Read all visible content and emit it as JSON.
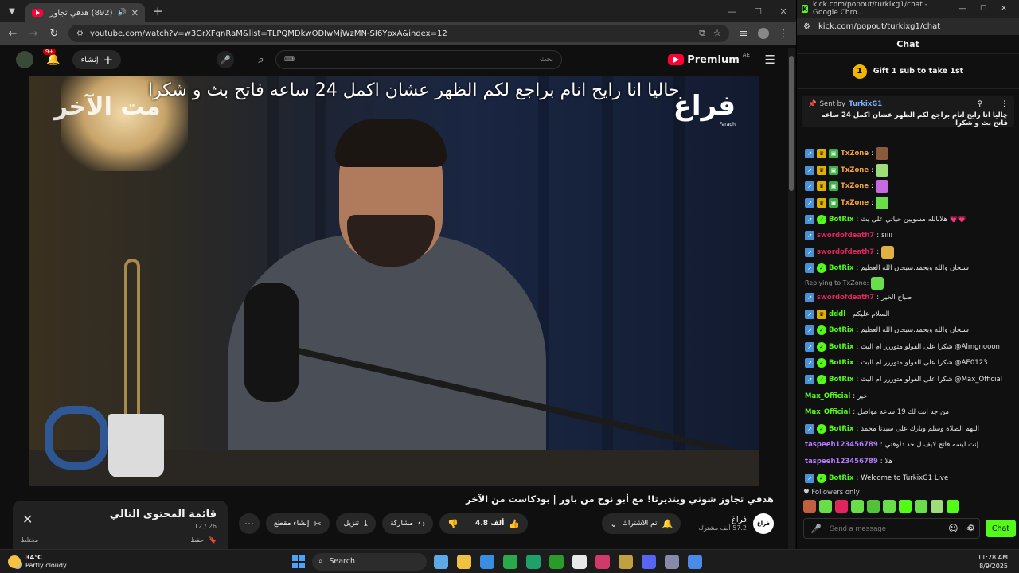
{
  "left_browser": {
    "tab_title": "(892) هدفي تجاوز شوني وينـ",
    "url": "youtube.com/watch?v=w3GrXFgnRaM&list=TLPQMDkwODIwMjWzMN-SI6YpxA&index=12",
    "win_controls": [
      "—",
      "☐",
      "✕"
    ]
  },
  "youtube": {
    "notif_count": "9+",
    "create_label": "إنشاء",
    "search_placeholder": "بحث",
    "premium_label": "Premium",
    "region": "AE",
    "video": {
      "caption": "حاليا انا رايح انام براجع لكم الظهر عشان اكمل 24 ساعه فاتح بث و شكرا",
      "brand_left": "مت الآخر",
      "brand_right": "فراغ",
      "brand_right_sub": "Faragh"
    },
    "title": "هدفي تجاوز شوني وينديرتا! مع أبو نوح من باور | بودكاست من الآخر",
    "channel": {
      "name": "فراغ",
      "subs": "57.2 ألف مشترك",
      "avatar_text": "فراغ"
    },
    "actions": {
      "subscribed": "تم الاشتراك",
      "likes": "4.8 ألف",
      "share": "مشاركة",
      "download": "تنزيل",
      "clip": "إنشاء مقطع",
      "more": "⋯"
    },
    "playlist": {
      "title": "قائمة المحتوى التالي",
      "count": "12 / 26",
      "save": "حفظ",
      "sort": "مختلط"
    }
  },
  "kick": {
    "window_title": "kick.com/popout/turkixg1/chat - Google Chro...",
    "url": "kick.com/popout/turkixg1/chat",
    "header": "Chat",
    "gift_text": "Gift 1 sub to take 1st",
    "gift_count": "1",
    "pinned": {
      "sent_by": "Sent by",
      "user": "TurkixG1",
      "message": "حاليا انا رايح انام براجع لكم الظهر عشان اكمل 24 ساعه فاتح بث و شكرا"
    },
    "messages": [
      {
        "user": "TxZone",
        "color": "#f2a33a",
        "text": "",
        "badges": [
          "link",
          "crown",
          "gift"
        ],
        "emote": "#8a5a3c"
      },
      {
        "user": "TxZone",
        "color": "#f2a33a",
        "text": "",
        "badges": [
          "link",
          "crown",
          "gift"
        ],
        "emote": "#9fdc7a"
      },
      {
        "user": "TxZone",
        "color": "#f2a33a",
        "text": "",
        "badges": [
          "link",
          "crown",
          "gift"
        ],
        "emote": "#c86adf"
      },
      {
        "user": "TxZone",
        "color": "#f2a33a",
        "text": "",
        "badges": [
          "link",
          "crown",
          "gift"
        ],
        "emote": "#6add4a"
      },
      {
        "user": "BotRix",
        "color": "#53fc18",
        "text": "هلابالله مسويين حياتي على بث 💗💗",
        "badges": [
          "link",
          "ver"
        ],
        "emote": ""
      },
      {
        "user": "swordofdeath7",
        "color": "#e0245e",
        "text": "siiii",
        "badges": [
          "link"
        ],
        "emote": ""
      },
      {
        "user": "swordofdeath7",
        "color": "#e0245e",
        "text": "",
        "badges": [
          "link"
        ],
        "emote": "#e0b040"
      },
      {
        "user": "BotRix",
        "color": "#53fc18",
        "text": "سبحان والله وبحمد.سبحان الله العظيم",
        "badges": [
          "link",
          "ver"
        ],
        "emote": ""
      },
      {
        "reply": "Replying to TxZone:",
        "emote": "#6add4a"
      },
      {
        "user": "swordofdeath7",
        "color": "#e0245e",
        "text": "صباح الخير",
        "badges": [
          "link"
        ],
        "emote": ""
      },
      {
        "user": "dddl",
        "color": "#53fc18",
        "text": "السلام عليكم",
        "badges": [
          "link",
          "crown"
        ],
        "emote": ""
      },
      {
        "user": "BotRix",
        "color": "#53fc18",
        "text": "سبحان والله وبحمد.سبحان الله العظيم",
        "badges": [
          "link",
          "ver"
        ],
        "emote": ""
      },
      {
        "user": "BotRix",
        "color": "#53fc18",
        "text": "شكرا على الفولو متوررر ام البث @Almgnooon",
        "badges": [
          "link",
          "ver"
        ],
        "emote": ""
      },
      {
        "user": "BotRix",
        "color": "#53fc18",
        "text": "شكرا على الفولو متوررر ام البث @AE0123",
        "badges": [
          "link",
          "ver"
        ],
        "emote": ""
      },
      {
        "user": "BotRix",
        "color": "#53fc18",
        "text": "شكرا على الفولو متوررر ام البث @Max_Official",
        "badges": [
          "link",
          "ver"
        ],
        "emote": ""
      },
      {
        "user": "Max_Official",
        "color": "#53fc18",
        "text": "خير",
        "badges": [],
        "emote": ""
      },
      {
        "user": "Max_Official",
        "color": "#53fc18",
        "text": "من جد انت لك 19 ساعه مواصل",
        "badges": [],
        "emote": ""
      },
      {
        "user": "BotRix",
        "color": "#53fc18",
        "text": "اللهم الصلاة وسلم وبارك على سيدنا محمد",
        "badges": [
          "link",
          "ver"
        ],
        "emote": ""
      },
      {
        "user": "taspeeh123456789",
        "color": "#b47aff",
        "text": "إنت ليسه فاتح لايف ل حد دلوقتي",
        "badges": [],
        "emote": ""
      },
      {
        "user": "taspeeh123456789",
        "color": "#b47aff",
        "text": "هلا",
        "badges": [],
        "emote": ""
      },
      {
        "user": "BotRix",
        "color": "#53fc18",
        "text": "Welcome to TurkixG1 Live",
        "badges": [
          "link",
          "ver"
        ],
        "emote": ""
      }
    ],
    "followers_only": "Followers only",
    "emote_bar": [
      "#c06040",
      "#6add4a",
      "#e0245e",
      "#6add4a",
      "#53c23a",
      "#6add4a",
      "#53fc18",
      "#6add4a",
      "#9fdc7a",
      "#53fc18"
    ],
    "input_placeholder": "Send a message",
    "chat_button": "Chat"
  },
  "taskbar": {
    "temp": "34°C",
    "weather": "Partly cloudy",
    "search": "Search",
    "time": "11:28 AM",
    "date": "8/9/2025",
    "app_colors": [
      "#5fa8e8",
      "#f0c040",
      "#3a8ee0",
      "#2aa84a",
      "#1fa06a",
      "#2a9a2a",
      "#e8e8e8",
      "#d03a6a",
      "#c0a040",
      "#5865f2",
      "#8888aa",
      "#4a8ae8"
    ]
  }
}
